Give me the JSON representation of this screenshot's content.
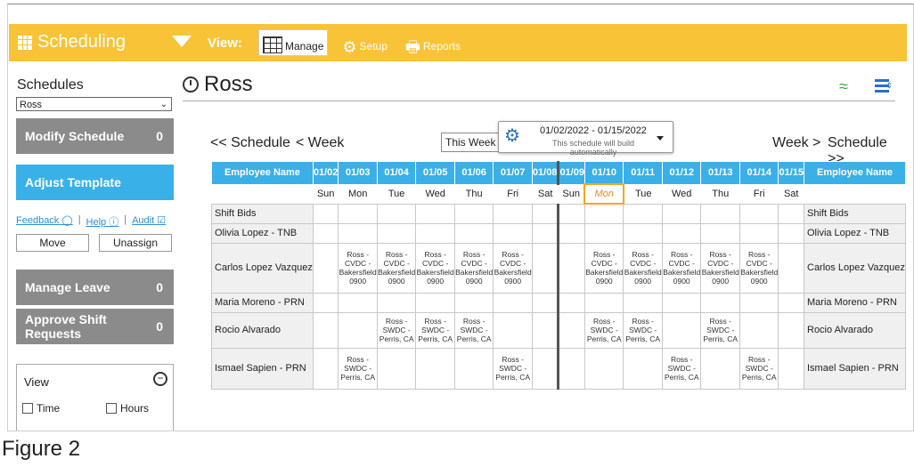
{
  "app": {
    "title": "Scheduling",
    "view_label": "View:"
  },
  "topnav": [
    {
      "label": "Manage",
      "icon": "table-icon",
      "active": true
    },
    {
      "label": "Setup",
      "icon": "gears-icon",
      "active": false
    },
    {
      "label": "Reports",
      "icon": "printer-icon",
      "active": false
    }
  ],
  "sidebar": {
    "title": "Schedules",
    "selected_schedule": "Ross",
    "modify": {
      "label": "Modify Schedule",
      "count": "0"
    },
    "adjust": {
      "label": "Adjust Template"
    },
    "links": {
      "feedback": "Feedback",
      "help": "Help",
      "audit": "Audit"
    },
    "move": "Move",
    "unassign": "Unassign",
    "leave": {
      "label": "Manage Leave",
      "count": "0"
    },
    "approve": {
      "label": "Approve Shift Requests",
      "count": "0"
    },
    "view_panel": {
      "title": "View",
      "opt_time": "Time",
      "opt_hours": "Hours"
    }
  },
  "main": {
    "title": "Ross",
    "prev_schedule": "<< Schedule",
    "prev_week": "< Week",
    "this_week": "This Week",
    "range": "01/02/2022 - 01/15/2022",
    "range_sub": "This schedule will build automatically",
    "next_week": "Week >",
    "next_schedule": "Schedule >>"
  },
  "table": {
    "name_header": "Employee Name",
    "dates": [
      "01/02",
      "01/03",
      "01/04",
      "01/05",
      "01/06",
      "01/07",
      "01/08",
      "01/09",
      "01/10",
      "01/11",
      "01/12",
      "01/13",
      "01/14",
      "01/15"
    ],
    "days": [
      "Sun",
      "Mon",
      "Tue",
      "Wed",
      "Thu",
      "Fri",
      "Sat",
      "Sun",
      "Mon",
      "Tue",
      "Wed",
      "Thu",
      "Fri",
      "Sat"
    ],
    "rows": [
      {
        "name": "Shift Bids",
        "cells": [
          "",
          "",
          "",
          "",
          "",
          "",
          "",
          "",
          "",
          "",
          "",
          "",
          "",
          ""
        ]
      },
      {
        "name": "Olivia Lopez - TNB",
        "cells": [
          "",
          "",
          "",
          "",
          "",
          "",
          "",
          "",
          "",
          "",
          "",
          "",
          "",
          ""
        ]
      },
      {
        "name": "Carlos Lopez Vazquez",
        "cells": [
          "",
          "Ross - CVDC - Bakersfield 0900",
          "Ross - CVDC - Bakersfield 0900",
          "Ross - CVDC - Bakersfield 0900",
          "Ross - CVDC - Bakersfield 0900",
          "Ross - CVDC - Bakersfield 0900",
          "",
          "",
          "Ross - CVDC - Bakersfield 0900",
          "Ross - CVDC - Bakersfield 0900",
          "Ross - CVDC - Bakersfield 0900",
          "Ross - CVDC - Bakersfield 0900",
          "Ross - CVDC - Bakersfield 0900",
          ""
        ]
      },
      {
        "name": "Maria Moreno - PRN",
        "cells": [
          "",
          "",
          "",
          "",
          "",
          "",
          "",
          "",
          "",
          "",
          "",
          "",
          "",
          ""
        ]
      },
      {
        "name": "Rocio Alvarado",
        "cells": [
          "",
          "",
          "Ross - SWDC - Perris, CA",
          "Ross - SWDC - Perris, CA",
          "Ross - SWDC - Perris, CA",
          "",
          "",
          "",
          "Ross - SWDC - Perris, CA",
          "Ross - SWDC - Perris, CA",
          "",
          "Ross - SWDC - Perris, CA",
          "",
          ""
        ]
      },
      {
        "name": "Ismael Sapien - PRN",
        "cells": [
          "",
          "Ross - SWDC - Perris, CA",
          "",
          "",
          "",
          "Ross - SWDC - Perris, CA",
          "",
          "",
          "",
          "",
          "Ross - SWDC - Perris, CA",
          "",
          "Ross - SWDC - Perris, CA",
          ""
        ]
      }
    ]
  },
  "caption": "Figure 2",
  "colors": {
    "topbar": "#f8c336",
    "header_blue": "#3ab0e8",
    "sidebar_gray": "#8b8b8b",
    "today_orange": "#f5a623"
  }
}
